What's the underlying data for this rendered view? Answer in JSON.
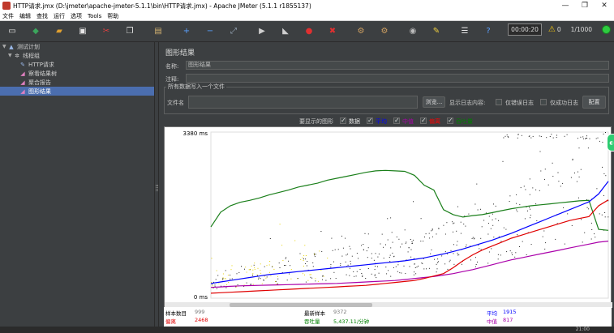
{
  "window": {
    "title": "HTTP请求.jmx (D:\\jmeter\\apache-jmeter-5.1.1\\bin\\HTTP请求.jmx) - Apache JMeter (5.1.1 r1855137)",
    "minimize": "—",
    "restore": "❐",
    "close": "✕"
  },
  "menu": [
    "文件",
    "编辑",
    "查找",
    "运行",
    "选项",
    "Tools",
    "帮助"
  ],
  "toolbar": {
    "icons": [
      {
        "name": "new-icon",
        "glyph": "▭",
        "color": "#e8e8e8"
      },
      {
        "name": "templates-icon",
        "glyph": "◆",
        "color": "#3ba55c"
      },
      {
        "name": "open-icon",
        "glyph": "▰",
        "color": "#e0a030"
      },
      {
        "name": "save-icon",
        "glyph": "▣",
        "color": "#e8e8e8"
      },
      {
        "name": "cut-icon",
        "glyph": "✂",
        "color": "#e04040"
      },
      {
        "name": "copy-icon",
        "glyph": "❐",
        "color": "#e8e8e8"
      },
      {
        "name": "paste-icon",
        "glyph": "▤",
        "color": "#d0b070"
      },
      {
        "name": "expand-icon",
        "glyph": "+",
        "color": "#5aa0ff"
      },
      {
        "name": "collapse-icon",
        "glyph": "−",
        "color": "#5aa0ff"
      },
      {
        "name": "toggle-icon",
        "glyph": "⤢",
        "color": "#9ab"
      },
      {
        "name": "start-icon",
        "glyph": "▶",
        "color": "#cfcfcf"
      },
      {
        "name": "start-no-pause-icon",
        "glyph": "◣",
        "color": "#cfcfcf"
      },
      {
        "name": "stop-icon",
        "glyph": "●",
        "color": "#e03030"
      },
      {
        "name": "shutdown-icon",
        "glyph": "✖",
        "color": "#e03030"
      },
      {
        "name": "clear-icon",
        "glyph": "⚙",
        "color": "#d0a060"
      },
      {
        "name": "clear-all-icon",
        "glyph": "⚙",
        "color": "#d0a060"
      },
      {
        "name": "search-icon",
        "glyph": "◉",
        "color": "#bbbbbb"
      },
      {
        "name": "reset-search-icon",
        "glyph": "✎",
        "color": "#f0d040"
      },
      {
        "name": "function-helper-icon",
        "glyph": "☰",
        "color": "#e8e8e8"
      },
      {
        "name": "help-icon",
        "glyph": "?",
        "color": "#5aa0ff"
      }
    ],
    "timer": "00:00:20",
    "warning_count": "0",
    "threads": "1/1000",
    "accent": "#3c3f41"
  },
  "tree": [
    {
      "label": "测试计划",
      "indent": 0,
      "icon": "test-plan-icon",
      "glyph": "▲",
      "color": "#9ab8e8",
      "arrow": "▼",
      "selected": false
    },
    {
      "label": "线程组",
      "indent": 1,
      "icon": "thread-group-icon",
      "glyph": "✲",
      "color": "#d0d0d0",
      "arrow": "▼",
      "selected": false
    },
    {
      "label": "HTTP请求",
      "indent": 2,
      "icon": "http-sampler-icon",
      "glyph": "✎",
      "color": "#9ab8e8",
      "arrow": "",
      "selected": false
    },
    {
      "label": "察看结果树",
      "indent": 2,
      "icon": "listener-icon",
      "glyph": "◢",
      "color": "#e080c0",
      "arrow": "",
      "selected": false
    },
    {
      "label": "聚合报告",
      "indent": 2,
      "icon": "listener-icon",
      "glyph": "◢",
      "color": "#e080c0",
      "arrow": "",
      "selected": false
    },
    {
      "label": "图形结果",
      "indent": 2,
      "icon": "listener-icon",
      "glyph": "◢",
      "color": "#e080c0",
      "arrow": "",
      "selected": true
    }
  ],
  "panel": {
    "title": "图形结果",
    "name_label": "名称:",
    "name_value": "图形结果",
    "comment_label": "注释:",
    "comment_value": "",
    "fileset_legend": "所有数据写入一个文件",
    "file_label": "文件名",
    "file_value": "",
    "browse": "浏览...",
    "log_content_label": "显示日志内容:",
    "errors_only": "仅错误日志",
    "success_only": "仅成功日志",
    "configure": "配置"
  },
  "graph_options": {
    "label": "要显示的图形",
    "items": [
      {
        "label": "数据",
        "color": "#000000"
      },
      {
        "label": "平均",
        "color": "#0000ff"
      },
      {
        "label": "中值",
        "color": "#aa00aa"
      },
      {
        "label": "偏离",
        "color": "#ff0000"
      },
      {
        "label": "吞吐量",
        "color": "#008000"
      }
    ]
  },
  "chart_data": {
    "type": "line",
    "title": "",
    "xlabel": "",
    "ylabel": "",
    "y_top_label": "3380 ms",
    "y_bottom_label": "0 ms",
    "ylim": [
      0,
      3380
    ],
    "n_samples": 999,
    "series": [
      {
        "name": "吞吐量",
        "color": "#1a7f1a",
        "values": [
          1450,
          1750,
          1880,
          1950,
          1990,
          2040,
          2100,
          2150,
          2200,
          2260,
          2300,
          2340,
          2400,
          2440,
          2480,
          2520,
          2560,
          2590,
          2600,
          2590,
          2580,
          2500,
          2300,
          2200,
          1800,
          1700,
          1650,
          1680,
          1700,
          1740,
          1780,
          1820,
          1850,
          1880,
          1900,
          1920,
          1940,
          1960,
          1980,
          1990,
          1400,
          1380
        ]
      },
      {
        "name": "平均",
        "color": "#0000ff",
        "values": [
          300,
          330,
          360,
          390,
          420,
          450,
          480,
          500,
          520,
          540,
          560,
          580,
          600,
          620,
          640,
          660,
          680,
          700,
          720,
          740,
          760,
          790,
          820,
          860,
          900,
          950,
          1000,
          1060,
          1120,
          1180,
          1250,
          1320,
          1400,
          1480,
          1560,
          1640,
          1720,
          1800,
          1880,
          1960,
          2120,
          2380
        ]
      },
      {
        "name": "中值",
        "color": "#aa00aa",
        "values": [
          220,
          230,
          240,
          250,
          255,
          260,
          265,
          270,
          275,
          280,
          285,
          290,
          295,
          300,
          310,
          320,
          330,
          340,
          350,
          360,
          380,
          400,
          420,
          440,
          470,
          500,
          540,
          580,
          630,
          680,
          730,
          780,
          820,
          860,
          900,
          940,
          980,
          1020,
          1060,
          1100,
          1140,
          1160
        ]
      },
      {
        "name": "偏离",
        "color": "#e00000",
        "values": [
          100,
          110,
          120,
          130,
          140,
          150,
          160,
          170,
          180,
          190,
          200,
          210,
          220,
          230,
          240,
          250,
          260,
          280,
          300,
          320,
          340,
          360,
          400,
          450,
          500,
          620,
          760,
          880,
          980,
          1060,
          1140,
          1220,
          1280,
          1340,
          1400,
          1460,
          1520,
          1580,
          1620,
          1660,
          1880,
          2000
        ]
      }
    ]
  },
  "legend": {
    "samples_label": "样本数目",
    "samples_value": "999",
    "latest_label": "最新样本",
    "latest_value": "9372",
    "average_label": "平均",
    "average_value": "1915",
    "deviation_label": "偏离",
    "deviation_value": "2468",
    "throughput_label": "吞吐量",
    "throughput_value": "5,437.11/分钟",
    "median_label": "中值",
    "median_value": "817"
  },
  "statusbar": {
    "clock": "21:00"
  }
}
